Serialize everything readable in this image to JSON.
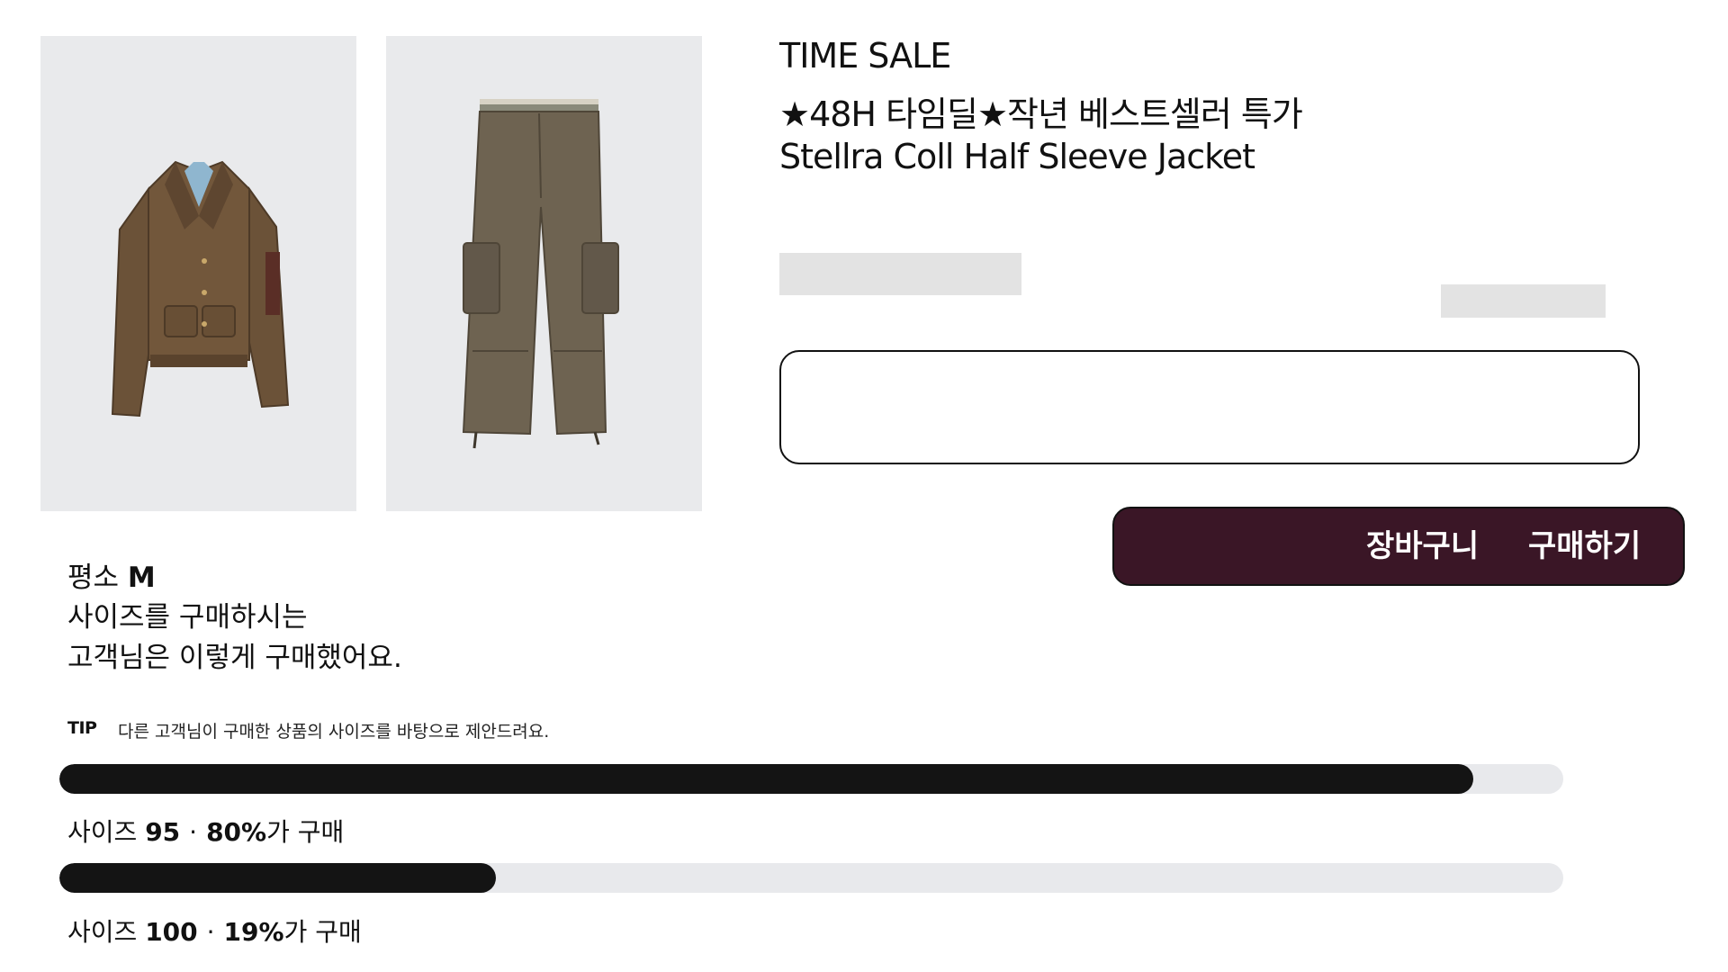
{
  "header": {
    "sale_label": "TIME SALE",
    "promo_line": "★48H 타임딜★작년 베스트셀러 특가",
    "product_name": "Stellra Coll Half Sleeve Jacket"
  },
  "actions": {
    "cart_label": "장바구니",
    "buy_label": "구매하기"
  },
  "recommendation": {
    "usual_prefix": "평소 ",
    "usual_size": "M",
    "line2": "사이즈를 구매하시는",
    "line3": "고객님은 이렇게 구매했어요.",
    "tip_label": "TIP",
    "tip_text": "다른 고객님이 구매한 상품의 사이즈를 바탕으로 제안드려요.",
    "sizes": [
      {
        "prefix": "사이즈 ",
        "size": "95",
        "separator": "·",
        "percent": "80%",
        "suffix": "가 구매",
        "share": 0.94
      },
      {
        "prefix": "사이즈 ",
        "size": "100",
        "separator": "·",
        "percent": "19%",
        "suffix": "가 구매",
        "share": 0.29
      }
    ]
  },
  "colors": {
    "action_bar": "#3a1626",
    "bar_fill": "#141414",
    "bar_track": "#e8e9ec",
    "image_bg": "#e9eaec"
  },
  "images": {
    "jacket": "brown-jacket-photo",
    "pants": "cargo-pants-photo"
  }
}
